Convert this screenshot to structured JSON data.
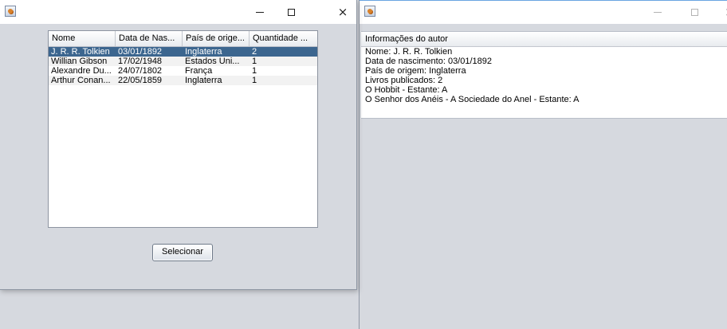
{
  "left_window": {
    "controls": {
      "minimize": "–",
      "maximize": "□",
      "close": "×"
    },
    "table": {
      "columns": [
        "Nome",
        "Data de Nas...",
        "País de orige...",
        "Quantidade ..."
      ],
      "rows": [
        [
          "J. R. R. Tolkien",
          "03/01/1892",
          "Inglaterra",
          "2"
        ],
        [
          "Willian Gibson",
          "17/02/1948",
          "Estados Uni...",
          "1"
        ],
        [
          "Alexandre Du...",
          "24/07/1802",
          "França",
          "1"
        ],
        [
          "Arthur Conan...",
          "22/05/1859",
          "Inglaterra",
          "1"
        ]
      ],
      "selected_row": 0
    },
    "button_label": "Selecionar"
  },
  "right_window": {
    "controls": {
      "minimize": "–",
      "maximize": "□",
      "close": "×"
    },
    "panel_header": "Informações do autor",
    "lines": [
      "Nome: J. R. R. Tolkien",
      "Data de nascimento: 03/01/1892",
      "País de origem: Inglaterra",
      "Livros publicados: 2",
      "O Hobbit - Estante: A",
      "O Senhor dos Anéis - A Sociedade do Anel - Estante: A"
    ]
  },
  "colors": {
    "selection": "#3c668f",
    "background": "#d6d9df"
  }
}
